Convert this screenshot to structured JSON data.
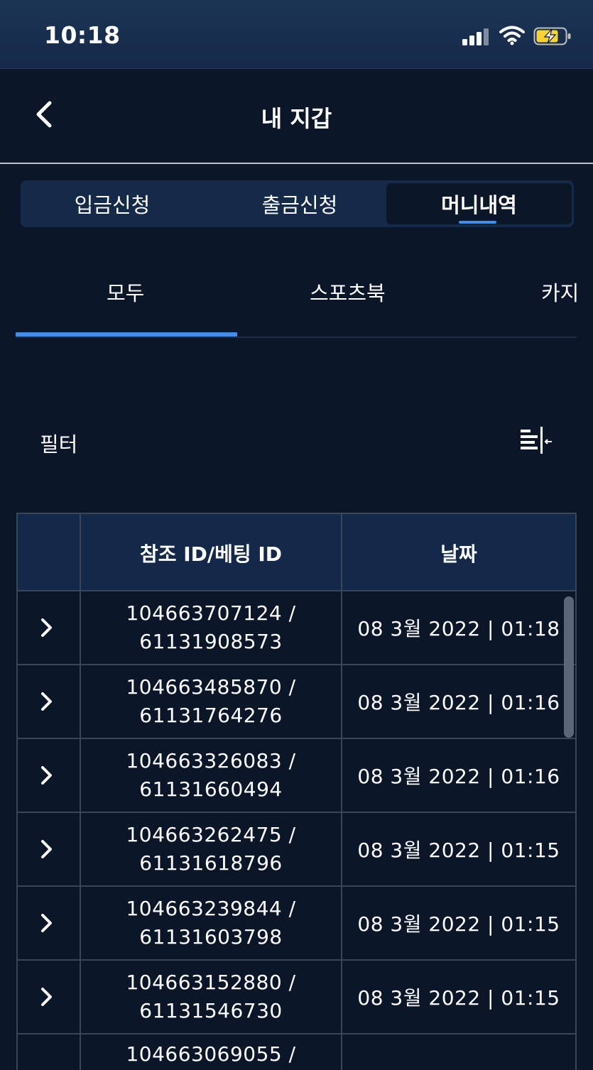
{
  "status": {
    "time": "10:18"
  },
  "header": {
    "title": "내 지갑"
  },
  "segment_tabs": [
    {
      "label": "입금신청",
      "active": false
    },
    {
      "label": "출금신청",
      "active": false
    },
    {
      "label": "머니내역",
      "active": true
    }
  ],
  "sub_tabs": [
    {
      "label": "모두",
      "active": true
    },
    {
      "label": "스포츠북",
      "active": false
    },
    {
      "label": "카지",
      "active": false
    }
  ],
  "filter": {
    "label": "필터",
    "icon": "filter-icon"
  },
  "table": {
    "headers": [
      "",
      "참조 ID/베팅 ID",
      "날짜"
    ],
    "rows": [
      {
        "ref_id": "104663707124 /",
        "bet_id": "61131908573",
        "date": "08 3월 2022 | 01:18"
      },
      {
        "ref_id": "104663485870 /",
        "bet_id": "61131764276",
        "date": "08 3월 2022 | 01:16"
      },
      {
        "ref_id": "104663326083 /",
        "bet_id": "61131660494",
        "date": "08 3월 2022 | 01:16"
      },
      {
        "ref_id": "104663262475 /",
        "bet_id": "61131618796",
        "date": "08 3월 2022 | 01:15"
      },
      {
        "ref_id": "104663239844 /",
        "bet_id": "61131603798",
        "date": "08 3월 2022 | 01:15"
      },
      {
        "ref_id": "104663152880 /",
        "bet_id": "61131546730",
        "date": "08 3월 2022 | 01:15"
      },
      {
        "ref_id": "104663069055 /",
        "bet_id": "",
        "date": ""
      }
    ]
  },
  "colors": {
    "background": "#0b1629",
    "accent": "#3f8ef0",
    "header_bg": "#14294a",
    "border": "#38465c",
    "battery": "#f7d332"
  }
}
